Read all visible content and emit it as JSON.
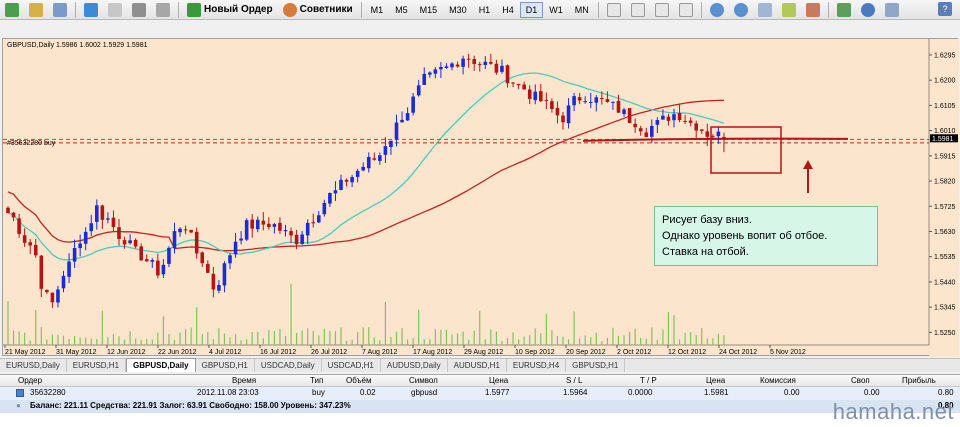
{
  "toolbar": {
    "new_order_label": "Новый Ордер",
    "advisors_label": "Советники",
    "timeframes": [
      "M1",
      "M5",
      "M15",
      "M30",
      "H1",
      "H4",
      "D1",
      "W1",
      "MN"
    ],
    "active_timeframe": "D1"
  },
  "chart": {
    "title": "GBPUSD,Daily  1.5986 1.6002 1.5929 1.5981",
    "order_label": "#35632280 buy",
    "price_labels": [
      "1.6295",
      "1.6200",
      "1.6105",
      "1.6010",
      "1.5915",
      "1.5820",
      "1.5725",
      "1.5630",
      "1.5535",
      "1.5440",
      "1.5345",
      "1.5250"
    ],
    "current_price": "1.5981",
    "date_labels": [
      "21 May 2012",
      "31 May 2012",
      "12 Jun 2012",
      "22 Jun 2012",
      "4 Jul 2012",
      "16 Jul 2012",
      "26 Jul 2012",
      "7 Aug 2012",
      "17 Aug 2012",
      "29 Aug 2012",
      "10 Sep 2012",
      "20 Sep 2012",
      "2 Oct 2012",
      "12 Oct 2012",
      "24 Oct 2012",
      "5 Nov 2012"
    ],
    "annotation_lines": [
      "Рисует базу вниз.",
      "Однако уровень вопит об отбое.",
      "Ставка на отбой."
    ],
    "colors": {
      "bull": "#1b2bd6",
      "bear": "#b31515",
      "ma_fast": "#4ec9c0",
      "ma_slow": "#c82020",
      "level": "#b31515",
      "background": "#fbe6cd"
    }
  },
  "symbol_tabs": [
    "EURUSD,Daily",
    "EURUSD,H1",
    "GBPUSD,Daily",
    "GBPUSD,H1",
    "USDCAD,Daily",
    "USDCAD,H1",
    "AUDUSD,Daily",
    "AUDUSD,H1",
    "EURUSD,H4",
    "GBPUSD,H1"
  ],
  "active_tab": "GBPUSD,Daily",
  "terminal": {
    "headers": {
      "order": "Ордер",
      "time": "Время",
      "type": "Тип",
      "volume": "Объём",
      "symbol": "Символ",
      "price": "Цена",
      "sl": "S / L",
      "tp": "T / P",
      "price2": "Цена",
      "commission": "Комиссия",
      "swap": "Своп",
      "profit": "Прибыль"
    },
    "order": {
      "order": "35632280",
      "time": "2012.11.08 23:03",
      "type": "buy",
      "volume": "0.02",
      "symbol": "gbpusd",
      "price": "1.5977",
      "sl": "1.5964",
      "tp": "0.0000",
      "price2": "1.5981",
      "commission": "0.00",
      "swap": "0.00",
      "profit": "0.80"
    },
    "balance_text": "Баланс: 221.11  Средства: 221.91  Залог: 63.91  Свободно: 158.00  Уровень: 347.23%",
    "balance_profit": "0.80"
  },
  "watermark": "hamaha.net"
}
